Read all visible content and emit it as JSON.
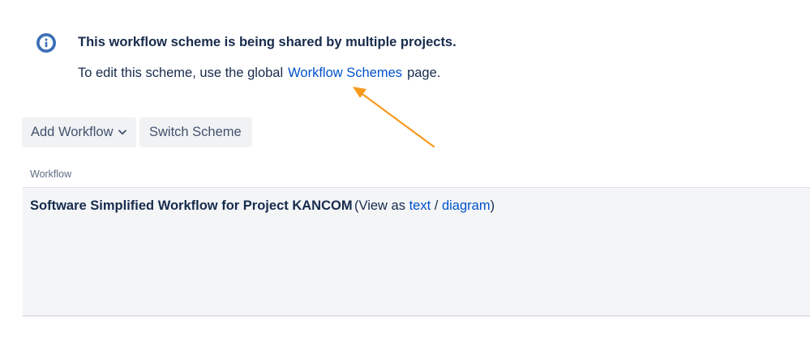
{
  "message": {
    "title": "This workflow scheme is being shared by multiple projects.",
    "text_before": "To edit this scheme, use the global",
    "link": "Workflow Schemes",
    "text_after": "page."
  },
  "toolbar": {
    "add_workflow_label": "Add Workflow",
    "switch_scheme_label": "Switch Scheme"
  },
  "table": {
    "column_header": "Workflow",
    "rows": [
      {
        "name": "Software Simplified Workflow for Project KANCOM",
        "view_as_prefix": "(View as",
        "text_link": "text",
        "separator": "/",
        "diagram_link": "diagram",
        "suffix": ")"
      }
    ]
  },
  "colors": {
    "link": "#0052cc",
    "annotation_arrow": "#f79a1e",
    "info_icon": "#3b6fb6"
  }
}
